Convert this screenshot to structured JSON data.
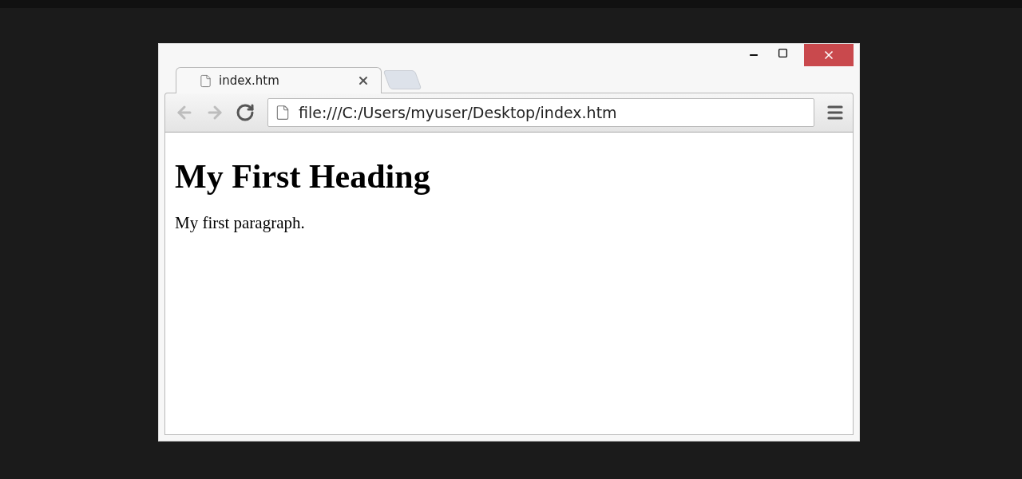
{
  "tabs": [
    {
      "title": "index.htm",
      "selected": true
    }
  ],
  "nav": [
    {
      "kind": "back",
      "disabled": true
    },
    {
      "kind": "forward",
      "disabled": true
    },
    {
      "kind": "reload",
      "disabled": false
    }
  ],
  "address": {
    "value": "file:///C:/Users/myuser/Desktop/index.htm"
  },
  "page": {
    "heading": "My First Heading",
    "paragraph": "My first paragraph."
  }
}
